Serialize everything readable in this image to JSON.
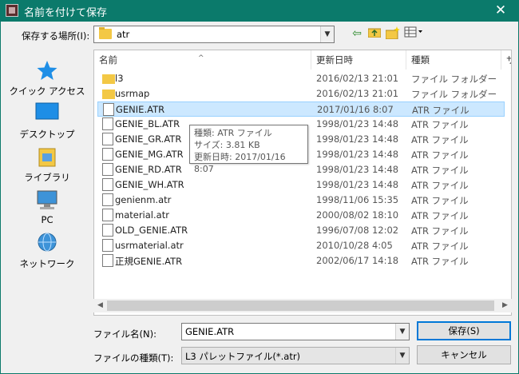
{
  "window": {
    "title": "名前を付けて保存",
    "close": "✕"
  },
  "toolbar": {
    "look_in_label": "保存する場所(I):",
    "look_in_value": "atr",
    "icons": [
      "back-arrow-icon",
      "up-folder-icon",
      "new-folder-icon",
      "view-menu-icon"
    ]
  },
  "places": [
    {
      "label": "クイック アクセス",
      "icon": "star-icon"
    },
    {
      "label": "デスクトップ",
      "icon": "desktop-icon"
    },
    {
      "label": "ライブラリ",
      "icon": "library-icon"
    },
    {
      "label": "PC",
      "icon": "pc-icon"
    },
    {
      "label": "ネットワーク",
      "icon": "network-icon"
    }
  ],
  "columns": [
    "名前",
    "更新日時",
    "種類",
    "サ"
  ],
  "files": [
    {
      "name": "l3",
      "date": "2016/02/13 21:01",
      "type": "ファイル フォルダー",
      "kind": "folder"
    },
    {
      "name": "usrmap",
      "date": "2016/02/13 21:01",
      "type": "ファイル フォルダー",
      "kind": "folder"
    },
    {
      "name": "GENIE.ATR",
      "date": "2017/01/16 8:07",
      "type": "ATR ファイル",
      "kind": "file",
      "selected": true
    },
    {
      "name": "GENIE_BL.ATR",
      "date": "1998/01/23 14:48",
      "type": "ATR ファイル",
      "kind": "file"
    },
    {
      "name": "GENIE_GR.ATR",
      "date": "1998/01/23 14:48",
      "type": "ATR ファイル",
      "kind": "file"
    },
    {
      "name": "GENIE_MG.ATR",
      "date": "1998/01/23 14:48",
      "type": "ATR ファイル",
      "kind": "file"
    },
    {
      "name": "GENIE_RD.ATR",
      "date": "1998/01/23 14:48",
      "type": "ATR ファイル",
      "kind": "file"
    },
    {
      "name": "GENIE_WH.ATR",
      "date": "1998/01/23 14:48",
      "type": "ATR ファイル",
      "kind": "file"
    },
    {
      "name": "genienm.atr",
      "date": "1998/11/06 15:35",
      "type": "ATR ファイル",
      "kind": "file"
    },
    {
      "name": "material.atr",
      "date": "2000/08/02 18:10",
      "type": "ATR ファイル",
      "kind": "file"
    },
    {
      "name": "OLD_GENIE.ATR",
      "date": "1996/07/08 12:02",
      "type": "ATR ファイル",
      "kind": "file"
    },
    {
      "name": "usrmaterial.atr",
      "date": "2010/10/28 4:05",
      "type": "ATR ファイル",
      "kind": "file"
    },
    {
      "name": "正規GENIE.ATR",
      "date": "2002/06/17 14:18",
      "type": "ATR ファイル",
      "kind": "file"
    }
  ],
  "tooltip": {
    "line1": "種類: ATR ファイル",
    "line2": "サイズ: 3.81 KB",
    "line3": "更新日時: 2017/01/16 8:07"
  },
  "form": {
    "filename_label": "ファイル名(N):",
    "filename_value": "GENIE.ATR",
    "filetype_label": "ファイルの種類(T):",
    "filetype_value": "L3 パレットファイル(*.atr)",
    "save_button": "保存(S)",
    "cancel_button": "キャンセル"
  },
  "colors": {
    "titlebar": "#0b7a6b",
    "selection": "#cce8ff",
    "folder": "#f3c845"
  }
}
